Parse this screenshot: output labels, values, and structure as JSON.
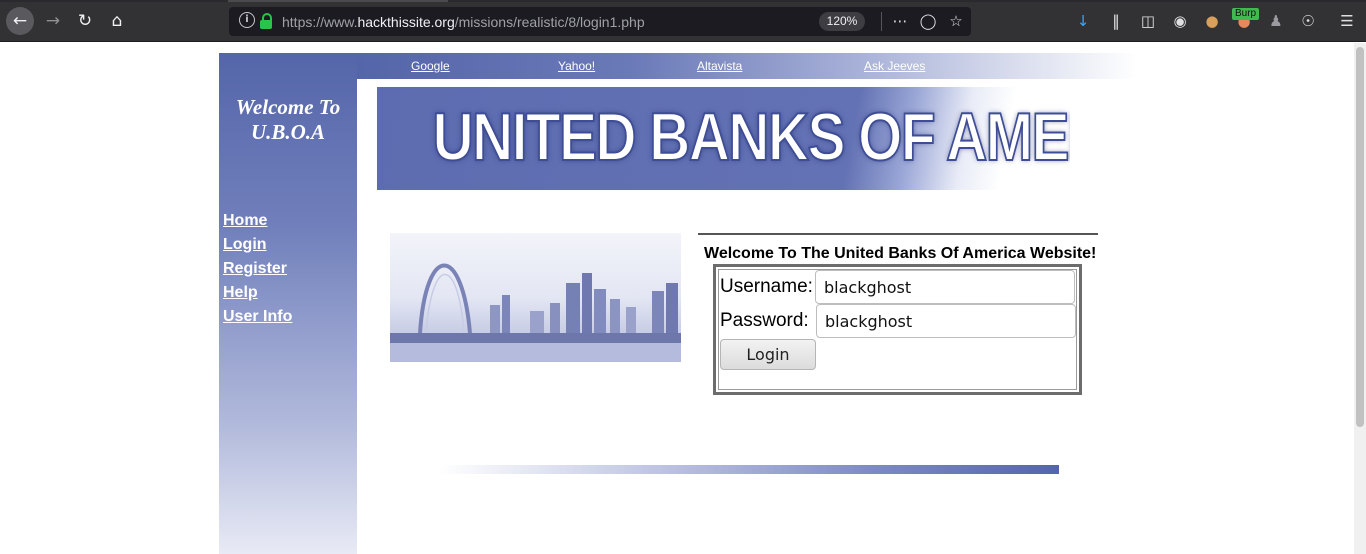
{
  "browser": {
    "url_prefix": "https://www.",
    "url_domain": "hackthissite.org",
    "url_path": "/missions/realistic/8/login1.php",
    "zoom": "120%",
    "burp_badge": "Burp",
    "icons": {
      "back": "back-arrow-icon",
      "forward": "forward-arrow-icon",
      "reload": "reload-icon",
      "home": "home-icon",
      "page_actions": "more-icon",
      "pocket": "pocket-icon",
      "bookmark": "star-icon",
      "download": "download-icon",
      "library": "library-icon",
      "sidebar": "sidebar-icon",
      "account": "account-icon",
      "cookie": "cookie-icon",
      "burp": "burp-extension-icon",
      "spy": "privacy-icon",
      "globe": "globe-icon",
      "menu": "hamburger-menu-icon"
    }
  },
  "page": {
    "welcome": "Welcome To U.B.O.A",
    "nav": [
      "Home",
      "Login",
      "Register",
      "Help",
      "User Info"
    ],
    "top_links": [
      "Google",
      "Yahoo!",
      "Altavista",
      "Ask Jeeves"
    ],
    "banner_text": "UNITED BANKS OF AMERICA",
    "panel_title": "Welcome To The United Banks Of America Website!",
    "login": {
      "username_label": "Username:",
      "username_value": "blackghost",
      "password_label": "Password:",
      "password_value": "blackghost",
      "button": "Login"
    },
    "colors": {
      "brand_blue": "#5465a9"
    }
  }
}
